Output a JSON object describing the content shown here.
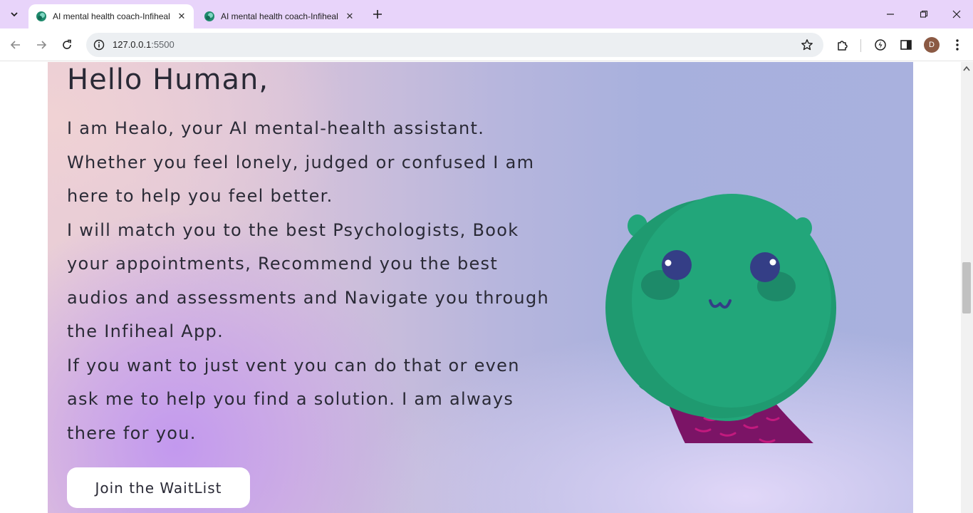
{
  "browser": {
    "tabs": [
      {
        "title": "AI mental health coach-Infiheal",
        "active": true
      },
      {
        "title": "AI mental health coach-Infiheal",
        "active": false
      }
    ],
    "url_host": "127.0.0.1",
    "url_port": ":5500",
    "profile_initial": "D",
    "icons": [
      "tab-search-icon",
      "close-icon",
      "new-tab-icon",
      "minimize-icon",
      "restore-icon",
      "window-close-icon",
      "back-icon",
      "forward-icon",
      "reload-icon",
      "site-info-icon",
      "bookmark-star-icon",
      "extensions-icon",
      "performance-icon",
      "side-panel-icon",
      "menu-icon"
    ]
  },
  "hero": {
    "title": "Hello Human,",
    "paragraphs": [
      "I am Healo, your AI mental-health assistant. Whether you feel lonely, judged or confused I am here to help you feel better.",
      "I will match you to the best Psychologists, Book your appointments, Recommend you the best audios and assessments and Navigate you through the Infiheal App.",
      "If you want to just vent you can do that or even ask me to help you find a solution. I am always there for you."
    ],
    "cta_label": "Join the WaitList"
  },
  "colors": {
    "tabstrip": "#e8d4fa",
    "mascot_green": "#22a67a",
    "cape_purple": "#7b1466",
    "eye_navy": "#343e86"
  }
}
